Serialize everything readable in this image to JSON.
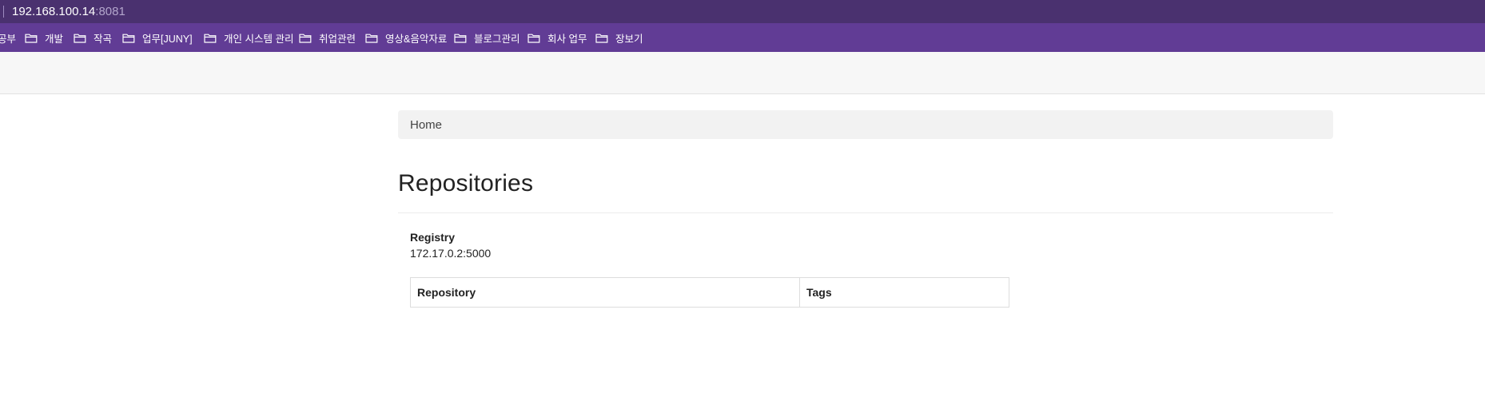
{
  "browser": {
    "address": {
      "host": "192.168.100.14",
      "port": ":8081"
    },
    "bookmarks": [
      {
        "label": "공부"
      },
      {
        "label": "개발"
      },
      {
        "label": "작곡"
      },
      {
        "label": "업무[JUNY]"
      },
      {
        "label": "개인 시스템 관리"
      },
      {
        "label": "취업관련"
      },
      {
        "label": "영상&음악자료"
      },
      {
        "label": "블로그관리"
      },
      {
        "label": "회사 업무"
      },
      {
        "label": "장보기"
      }
    ]
  },
  "breadcrumb": {
    "home": "Home"
  },
  "page": {
    "title": "Repositories"
  },
  "registry": {
    "label": "Registry",
    "value": "172.17.0.2:5000"
  },
  "table": {
    "columns": [
      "Repository",
      "Tags"
    ],
    "rows": []
  }
}
